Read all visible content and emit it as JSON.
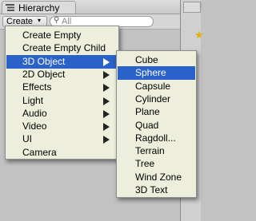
{
  "window": {
    "tab_title": "Hierarchy",
    "panel_menu_glyph": "▾≡"
  },
  "toolbar": {
    "create_label": "Create",
    "create_arrow": "▾",
    "search_placeholder": "All"
  },
  "menu": {
    "items": [
      {
        "label": "Create Empty",
        "submenu": false
      },
      {
        "label": "Create Empty Child",
        "submenu": false
      },
      {
        "label": "3D Object",
        "submenu": true,
        "selected": true
      },
      {
        "label": "2D Object",
        "submenu": true
      },
      {
        "label": "Effects",
        "submenu": true
      },
      {
        "label": "Light",
        "submenu": true
      },
      {
        "label": "Audio",
        "submenu": true
      },
      {
        "label": "Video",
        "submenu": true
      },
      {
        "label": "UI",
        "submenu": true
      },
      {
        "label": "Camera",
        "submenu": false
      }
    ]
  },
  "submenu": {
    "items": [
      {
        "label": "Cube"
      },
      {
        "label": "Sphere",
        "selected": true
      },
      {
        "label": "Capsule"
      },
      {
        "label": "Cylinder"
      },
      {
        "label": "Plane"
      },
      {
        "label": "Quad"
      },
      {
        "label": "Ragdoll..."
      },
      {
        "label": "Terrain"
      },
      {
        "label": "Tree"
      },
      {
        "label": "Wind Zone"
      },
      {
        "label": "3D Text"
      }
    ]
  },
  "colors": {
    "highlight": "#2a62c9",
    "menu_bg": "#eeeedd"
  }
}
